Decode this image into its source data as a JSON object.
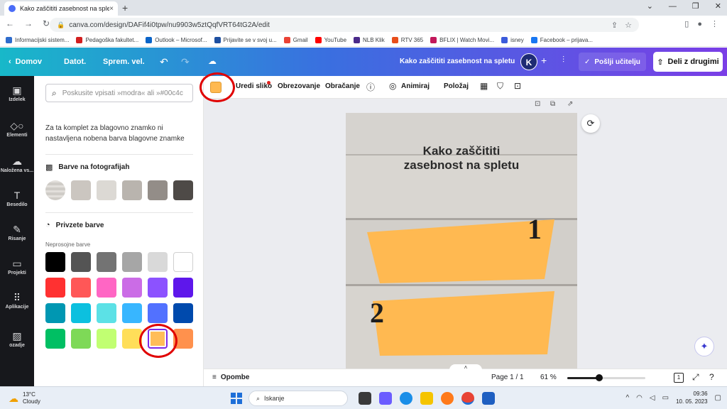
{
  "browser": {
    "tab_title": "Kako zaščititi zasebnost na splet",
    "tab_close": "×",
    "new_tab": "+",
    "url": "canva.com/design/DAFif4i0tpw/nu9903w5ztQqfVRT64tG2A/edit",
    "bookmarks": [
      {
        "label": "Informacijski sistem...",
        "color": "#2f6ccc"
      },
      {
        "label": "Pedagoška fakultet...",
        "color": "#d21f1f"
      },
      {
        "label": "Outlook – Microsof...",
        "color": "#0a64c8"
      },
      {
        "label": "Prijavite se v svoj u...",
        "color": "#1e4fa0"
      },
      {
        "label": "Gmail",
        "color": "#ea4335"
      },
      {
        "label": "YouTube",
        "color": "#ff0000"
      },
      {
        "label": "NLB Klik",
        "color": "#4a2a8a"
      },
      {
        "label": "RTV 365",
        "color": "#e84e1b"
      },
      {
        "label": "BFLIX | Watch Movi...",
        "color": "#c2185b"
      },
      {
        "label": "isney",
        "color": "#3b5bdb"
      },
      {
        "label": "Facebook – prijava...",
        "color": "#1877f2"
      }
    ]
  },
  "header": {
    "home": "Domov",
    "file": "Datot.",
    "resize": "Sprem. vel.",
    "doc_title": "Kako zaščititi zasebnost na spletu",
    "avatar_letter": "K",
    "send_teacher": "Pošlji učitelju",
    "share": "Deli z drugimi"
  },
  "rail": [
    {
      "label": "Izdelek",
      "icon": "▣"
    },
    {
      "label": "Elementi",
      "icon": "◇○"
    },
    {
      "label": "Naložena vs...",
      "icon": "☁"
    },
    {
      "label": "Besedilo",
      "icon": "T"
    },
    {
      "label": "Risanje",
      "icon": "✎"
    },
    {
      "label": "Projekti",
      "icon": "▭"
    },
    {
      "label": "Aplikacije",
      "icon": "⠿"
    },
    {
      "label": "ozadje",
      "icon": "▨"
    }
  ],
  "panel": {
    "search_placeholder": "Poskusite vpisati »modra« ali »#00c4c",
    "brand_message": "Za ta komplet za blagovno znamko ni nastavljena nobena barva blagovne znamke",
    "photo_colors_title": "Barve na fotografijah",
    "photo_colors": [
      "#d6d3cf",
      "#cbc6c0",
      "#dcd9d4",
      "#b9b4ae",
      "#938d88",
      "#4e4a47"
    ],
    "default_colors_title": "Privzete barve",
    "default_colors_sub": "Neprosojne barve",
    "default_colors": [
      [
        "#000000",
        "#545454",
        "#737373",
        "#a6a6a6",
        "#d9d9d9",
        "#ffffff"
      ],
      [
        "#ff3131",
        "#ff5757",
        "#ff66c4",
        "#cb6ce6",
        "#8c52ff",
        "#5e17eb"
      ],
      [
        "#0097b2",
        "#0cc0df",
        "#5ce1e6",
        "#38b6ff",
        "#5271ff",
        "#004aad"
      ],
      [
        "#00bf63",
        "#7ed957",
        "#c1ff72",
        "#ffde59",
        "#ffbd59",
        "#ff914d"
      ]
    ]
  },
  "toolbar": {
    "edit_image": "Uredi sliko",
    "crop": "Obrezovanje",
    "flip": "Obračanje",
    "animate": "Animiraj",
    "position": "Položaj"
  },
  "design": {
    "title_line1": "Kako zaščititi",
    "title_line2": "zasebnost na spletu",
    "num1": "1",
    "num2": "2",
    "shape_color": "#ffb951"
  },
  "bottom": {
    "notes": "Opombe",
    "page": "Page 1 / 1",
    "zoom": "61 %",
    "zoom_value": 61,
    "page_count_badge": "1"
  },
  "taskbar": {
    "temp": "13°C",
    "weather": "Cloudy",
    "search": "Iskanje",
    "time": "09:36",
    "date": "10. 05. 2023"
  },
  "colors": {
    "annotation": "#e00000",
    "selected_swatch": "#ffbd59"
  }
}
